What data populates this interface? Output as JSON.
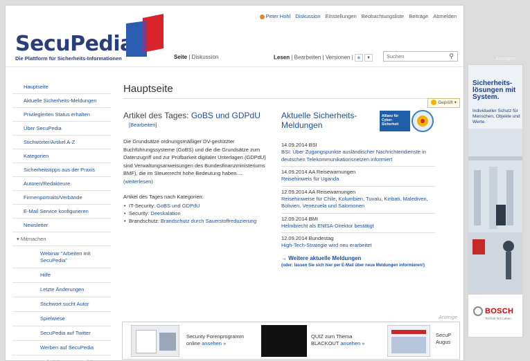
{
  "header": {
    "logo_text": "SecuPedia",
    "logo_subtitle": "Die Plattform für Sicherheits-Informationen",
    "user_links": [
      "Peter Hohl",
      "Diskussion",
      "Einstellungen",
      "Beobachtungsliste",
      "Beiträge",
      "Abmelden"
    ],
    "page_tabs": {
      "page": "Seite",
      "separator": "|",
      "discussion": "Diskussion"
    },
    "view_tabs": {
      "read": "Lesen",
      "edit": "Bearbeiten",
      "versions": "Versionen"
    },
    "search_placeholder": "Suchen"
  },
  "sidebar": {
    "items": [
      "Hauptseite",
      "Aktuelle Sicherheits-Meldungen",
      "Privilegierten Status erhalten",
      "Über SecuPedia",
      "Stichwörter/Artikel A-Z",
      "Kategorien",
      "Sicherheitstipps aus der Praxis",
      "Autoren/Redakteure",
      "Firmenportraits/Verbände",
      "E-Mail Service konfigurieren",
      "Newsletter"
    ],
    "section_label": "Mitmachen",
    "sub_items": [
      "Webinar \"Arbeiten mit SecuPedia\"",
      "Hilfe",
      "Letzte Änderungen",
      "Stichwort sucht Autor",
      "Spielwiese",
      "SecuPedia auf Twitter",
      "Werben auf SecuPedia",
      "Artikel des Tages auf Ihrer"
    ]
  },
  "main": {
    "page_title": "Hauptseite",
    "badge": "Geprüft",
    "article_heading_prefix": "Artikel des Tages:",
    "article_heading_topic": "GoBS und GDPdU",
    "edit_link": "[Bearbeiten]",
    "article_text": "Die Grundsätze ordnungsmäßiger DV-gestützter Buchführungssysteme (GoBS) und die die Grundsätze zum Datenzugriff und zur Prüfbarkeit digitaler Unterlagen (GDPdU) sind Verwaltungsanweisungen des Bundesfinanzministeriums BMF), die im Steuerrecht hohe Bedeutung haben....",
    "read_more": "(weiterlesen)",
    "categories_heading": "Artikel des Tages nach Kategorien:",
    "categories": [
      {
        "label": "IT-Security:",
        "link": "GoBS und GDPdU"
      },
      {
        "label": "Security:",
        "link": "Deeskalation"
      },
      {
        "label": "Brandschutz:",
        "link": "Brandschutz durch Sauerstoffreduzierung"
      }
    ],
    "news_heading": "Aktuelle Sicherheits-Meldungen",
    "news_logo_text": "Allianz für Cyber-Sicherheit",
    "news": [
      {
        "date": "14.09.2014 BSI",
        "link": "BSI: Über Zugangspunkte ausländischer Nachrichtendienste in deutschen Telekommunikationsnetzen informiert"
      },
      {
        "date": "14.09.2014 AA Reisewarnungen",
        "link": "Reisehinweis für Uganda"
      },
      {
        "date": "12.09.2014 AA Reisewarnungen",
        "link": "Reisehinweise für Chile, Kolumbien, Tuvalu, Kiribati, Malediven, Bolivien, Venezuela und Salomonen"
      },
      {
        "date": "12.09.2014 BMI",
        "link": "Helmbrecht als ENISA-Direktor bestätigt"
      },
      {
        "date": "12.09.2014 Bundestag",
        "link": "High-Tech-Strategie wird neu erarbeitet"
      }
    ],
    "more_news": "→ Weitere aktuelle Meldungen",
    "more_news_sub": "(oder: lassen Sie sich hier per E-Mail über neue Meldungen informieren!)"
  },
  "bottom_ad": {
    "label": "Anzeige",
    "items": [
      {
        "text": "Security Forenprogramm online",
        "link": "ansehen »"
      },
      {
        "text": "QUIZ zum Thema BLACKOUT",
        "link": "ansehen »"
      },
      {
        "text": "SecuP Augus",
        "link": ""
      }
    ]
  },
  "right_ad": {
    "label": "Anzeigen",
    "headline": "Sicherheits-lösungen mit System.",
    "subline": "Individueller Schutz für Menschen, Objekte und Werte.",
    "brand": "BOSCH",
    "tagline": "Technik fürs Leben"
  },
  "colors": {
    "brand_blue": "#2a3f7a",
    "link": "#1a4f9c",
    "bosch_red": "#d40000"
  }
}
